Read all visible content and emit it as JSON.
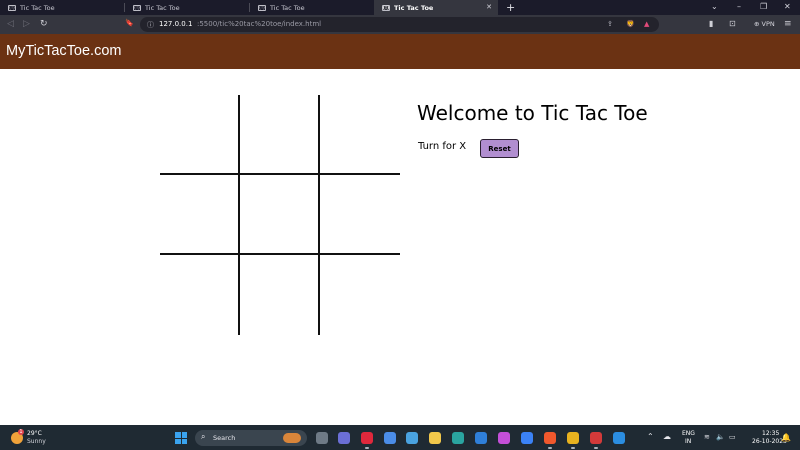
{
  "browser": {
    "tabs": [
      {
        "title": "Tic Tac Toe",
        "active": false
      },
      {
        "title": "Tic Tac Toe",
        "active": false
      },
      {
        "title": "Tic Tac Toe",
        "active": false
      },
      {
        "title": "Tic Tac Toe",
        "active": true
      }
    ],
    "new_tab_icon": "+",
    "favicon_text": "{!}",
    "close_icon": "✕",
    "window_controls": {
      "tabs_search": "⌄",
      "minimize": "–",
      "maximize": "❐",
      "close": "✕"
    },
    "nav": {
      "back": "◁",
      "forward": "▷",
      "reload": "↻",
      "bookmark": "🔖"
    },
    "address": {
      "info_icon": "ⓘ",
      "host": "127.0.0.1",
      "rest": ":5500/tic%20tac%20toe/index.html"
    },
    "toolbar_icons": {
      "share": "⇪",
      "brave_shield": "🦁",
      "rewards": "▲",
      "sidebar": "▮",
      "wallet": "⊡",
      "menu": "≡"
    },
    "vpn_label": "⊕ VPN"
  },
  "site": {
    "brand": "MyTicTacToe.com",
    "header_color": "#6b3213"
  },
  "game": {
    "board": [
      "",
      "",
      "",
      "",
      "",
      "",
      "",
      "",
      ""
    ],
    "title": "Welcome to Tic Tac Toe",
    "turn_text": "Turn for X",
    "reset_label": "Reset",
    "reset_color": "#b18ed0"
  },
  "taskbar": {
    "weather": {
      "badge": "1",
      "temp": "29°C",
      "condition": "Sunny"
    },
    "search_icon": "⌕",
    "search_label": "Search",
    "apps": [
      {
        "name": "file-explorer-app",
        "color": "#6e7a86"
      },
      {
        "name": "teams-app",
        "color": "#6b6fd6"
      },
      {
        "name": "opera-app",
        "color": "#e0283c"
      },
      {
        "name": "cortana-app",
        "color": "#4b8de8"
      },
      {
        "name": "monitor-app",
        "color": "#4aa3e0"
      },
      {
        "name": "folder-app",
        "color": "#f2c84b"
      },
      {
        "name": "edge-app",
        "color": "#2aa4a0"
      },
      {
        "name": "mail-app",
        "color": "#2f7fd8"
      },
      {
        "name": "photos-app",
        "color": "#c44fd8"
      },
      {
        "name": "dropbox-app",
        "color": "#3b82f6"
      },
      {
        "name": "brave-app",
        "color": "#f1582d"
      },
      {
        "name": "chrome-app",
        "color": "#e8b21f"
      },
      {
        "name": "media-app",
        "color": "#d33a3a"
      },
      {
        "name": "vscode-app",
        "color": "#2b8de0"
      }
    ],
    "tray": {
      "chevron": "⌃",
      "cloud": "☁",
      "lang_line1": "ENG",
      "lang_line2": "IN",
      "wifi": "≋",
      "volume": "🔈",
      "battery": "▭"
    },
    "clock_time": "12:35",
    "clock_date": "26-10-2023",
    "notifications_icon": "🔔"
  }
}
